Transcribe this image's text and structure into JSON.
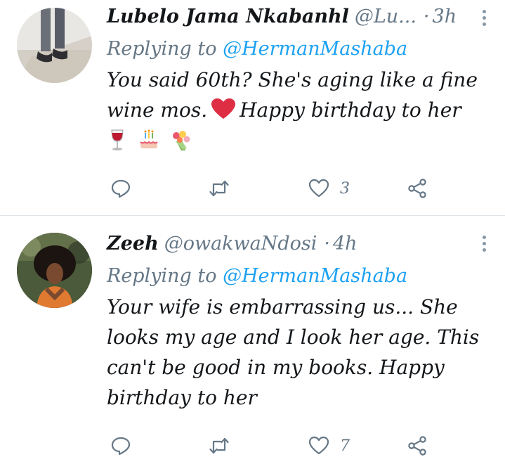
{
  "tweets": [
    {
      "display_name": "Lubelo Jama Nkabanhl",
      "handle": "@Lu...",
      "separator": "·",
      "time": "3h",
      "replying_prefix": "Replying to",
      "replying_to": "@HermanMashaba",
      "text_before_emoji": "You said 60th? She's aging like a fine wine mos.",
      "text_after_emoji": "Happy birthday to her",
      "inline_emoji": "red-heart",
      "emojis": [
        "wine-glass",
        "birthday-cake",
        "bouquet"
      ],
      "likes": "3"
    },
    {
      "display_name": "Zeeh",
      "handle": "@owakwaNdosi",
      "separator": "·",
      "time": "4h",
      "replying_prefix": "Replying to",
      "replying_to": "@HermanMashaba",
      "text": "Your wife is embarrassing us... She looks my age and I look her age. This can't be good in my books. Happy birthday to her",
      "likes": "7"
    }
  ],
  "colors": {
    "text": "#14171a",
    "secondary": "#657786",
    "accent": "#1da1f2",
    "divider": "#dfe4e8",
    "icon": "#657786"
  }
}
